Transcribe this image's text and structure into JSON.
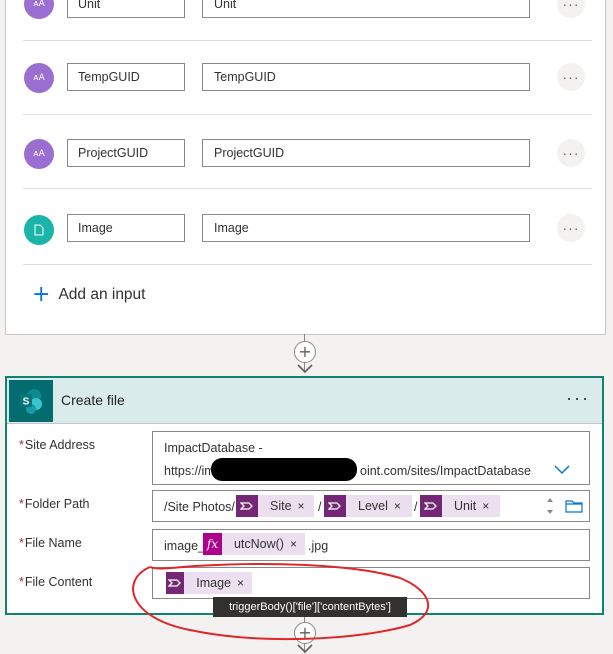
{
  "trigger": {
    "inputs": [
      {
        "icon": "text-input-icon",
        "name": "Unit",
        "value": "Unit"
      },
      {
        "icon": "text-input-icon",
        "name": "TempGUID",
        "value": "TempGUID"
      },
      {
        "icon": "text-input-icon",
        "name": "ProjectGUID",
        "value": "ProjectGUID"
      },
      {
        "icon": "file-input-icon",
        "name": "Image",
        "value": "Image"
      }
    ],
    "add_input_label": "Add an input",
    "more_glyph": "···"
  },
  "action": {
    "title": "Create file",
    "more_glyph": "···",
    "fields": {
      "site_address": {
        "label": "Site Address",
        "line1": "ImpactDatabase -",
        "line2_prefix": "https://im",
        "line2_suffix": "oint.com/sites/ImpactDatabase"
      },
      "folder_path": {
        "label": "Folder Path",
        "prefix": "/Site Photos/",
        "tokens": [
          "Site",
          "Level",
          "Unit"
        ],
        "separator": "/"
      },
      "file_name": {
        "label": "File Name",
        "prefix": "image_",
        "token": "utcNow()",
        "suffix": ".jpg"
      },
      "file_content": {
        "label": "File Content",
        "token": "Image"
      }
    },
    "required_mark": "*",
    "token_close": "×"
  },
  "tooltip": "triggerBody()['file']['contentBytes']",
  "colors": {
    "accent": "#0078d4",
    "sharepoint": "#036c70",
    "powerautomate_token": "#742774",
    "expression_token": "#ad008c",
    "annotation": "#e0262b"
  }
}
